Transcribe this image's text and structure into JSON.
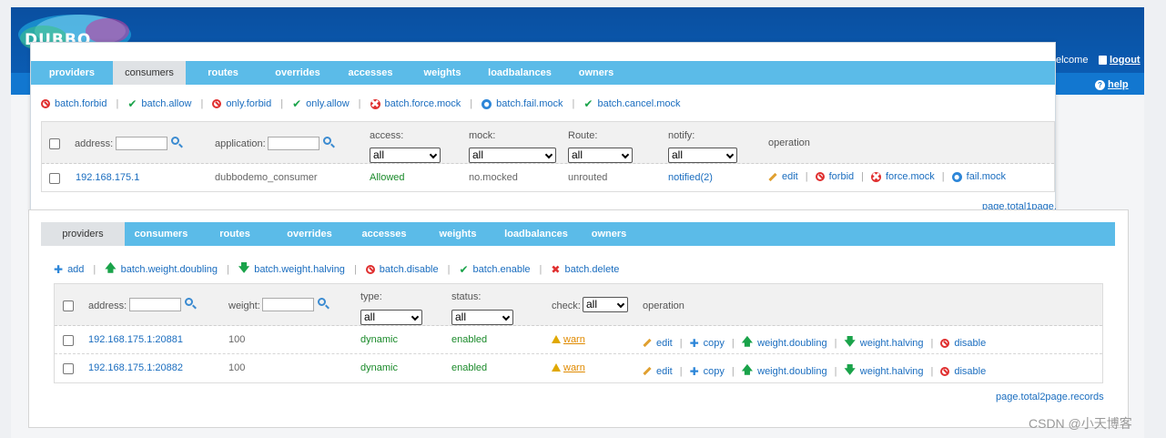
{
  "header": {
    "logo_text": "DUBBO",
    "welcome": "elcome",
    "logout": "logout",
    "help": "help"
  },
  "consumers_panel": {
    "tabs": [
      "providers",
      "consumers",
      "routes",
      "overrides",
      "accesses",
      "weights",
      "loadbalances",
      "owners"
    ],
    "active_tab": "consumers",
    "actions": [
      "batch.forbid",
      "batch.allow",
      "only.forbid",
      "only.allow",
      "batch.force.mock",
      "batch.fail.mock",
      "batch.cancel.mock"
    ],
    "filters": {
      "address_label": "address:",
      "application_label": "application:",
      "access_label": "access:",
      "access_value": "all",
      "mock_label": "mock:",
      "mock_value": "all",
      "route_label": "Route:",
      "route_value": "all",
      "notify_label": "notify:",
      "notify_value": "all",
      "operation_label": "operation"
    },
    "rows": [
      {
        "address": "192.168.175.1",
        "application": "dubbodemo_consumer",
        "access": "Allowed",
        "mock": "no.mocked",
        "route": "unrouted",
        "notify": "notified(2)",
        "ops": [
          "edit",
          "forbid",
          "force.mock",
          "fail.mock"
        ]
      }
    ],
    "page_info": "page.total1page."
  },
  "providers_panel": {
    "tabs": [
      "providers",
      "consumers",
      "routes",
      "overrides",
      "accesses",
      "weights",
      "loadbalances",
      "owners"
    ],
    "active_tab": "providers",
    "actions": [
      "add",
      "batch.weight.doubling",
      "batch.weight.halving",
      "batch.disable",
      "batch.enable",
      "batch.delete"
    ],
    "filters": {
      "address_label": "address:",
      "weight_label": "weight:",
      "type_label": "type:",
      "type_value": "all",
      "status_label": "status:",
      "status_value": "all",
      "check_label": "check:",
      "check_value": "all",
      "operation_label": "operation"
    },
    "rows": [
      {
        "address": "192.168.175.1:20881",
        "weight": "100",
        "type": "dynamic",
        "status": "enabled",
        "check": "warn",
        "ops": [
          "edit",
          "copy",
          "weight.doubling",
          "weight.halving",
          "disable"
        ]
      },
      {
        "address": "192.168.175.1:20882",
        "weight": "100",
        "type": "dynamic",
        "status": "enabled",
        "check": "warn",
        "ops": [
          "edit",
          "copy",
          "weight.doubling",
          "weight.halving",
          "disable"
        ]
      }
    ],
    "page_info": "page.total2page.records"
  },
  "watermark": "CSDN @小天博客",
  "colors": {
    "header": "#0a4fa0",
    "tabbar": "#5bbbe8",
    "link": "#1a6dbf",
    "status_green": "#1a8a2a"
  }
}
